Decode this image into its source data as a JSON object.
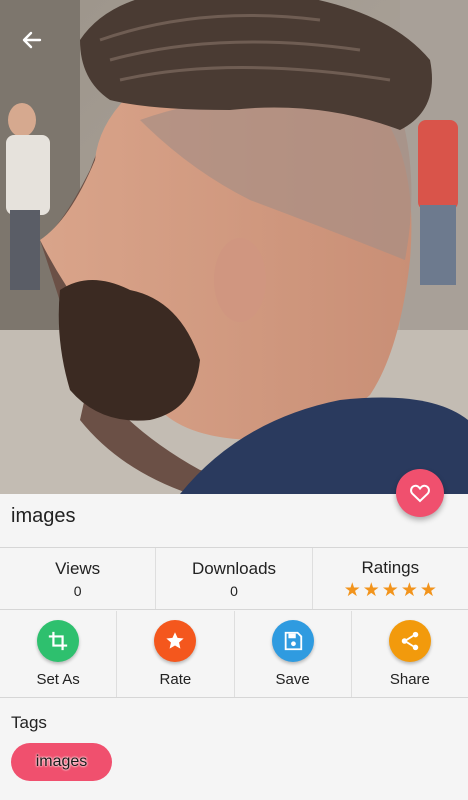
{
  "page": {
    "title": "images"
  },
  "stats": {
    "views": {
      "label": "Views",
      "value": "0"
    },
    "downloads": {
      "label": "Downloads",
      "value": "0"
    },
    "ratings": {
      "label": "Ratings",
      "stars": 5
    }
  },
  "actions": [
    {
      "label": "Set As",
      "icon": "crop-icon",
      "color": "#2ec06e"
    },
    {
      "label": "Rate",
      "icon": "star-icon",
      "color": "#f4571d"
    },
    {
      "label": "Save",
      "icon": "save-icon",
      "color": "#2f9be0"
    },
    {
      "label": "Share",
      "icon": "share-icon",
      "color": "#f29a0c"
    }
  ],
  "tags": {
    "heading": "Tags",
    "items": [
      "images"
    ]
  },
  "colors": {
    "accent": "#f0506e",
    "star": "#f2941c"
  }
}
